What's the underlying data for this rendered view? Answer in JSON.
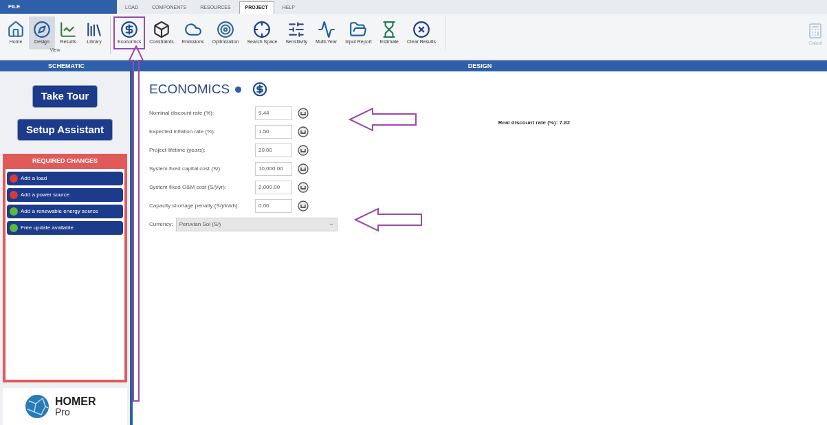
{
  "file_menu": "FILE",
  "menu_tabs": [
    {
      "label": "LOAD",
      "selected": false
    },
    {
      "label": "COMPONENTS",
      "selected": false
    },
    {
      "label": "RESOURCES",
      "selected": false
    },
    {
      "label": "PROJECT",
      "selected": true
    },
    {
      "label": "HELP",
      "selected": false
    }
  ],
  "ribbon": {
    "view_group": {
      "label": "View",
      "tools": [
        {
          "label": "Home",
          "selected": false
        },
        {
          "label": "Design",
          "selected": true
        },
        {
          "label": "Results",
          "selected": false
        },
        {
          "label": "Library",
          "selected": false
        }
      ]
    },
    "project_tools": [
      {
        "label": "Economics",
        "highlighted": true
      },
      {
        "label": "Constraints",
        "highlighted": false
      },
      {
        "label": "Emissions",
        "highlighted": false
      },
      {
        "label": "Optimization",
        "highlighted": false
      },
      {
        "label": "Search Space",
        "highlighted": false
      },
      {
        "label": "Sensitivity",
        "highlighted": false
      },
      {
        "label": "Multi-Year",
        "highlighted": false
      },
      {
        "label": "Input Report",
        "highlighted": false
      },
      {
        "label": "Estimate",
        "highlighted": false
      },
      {
        "label": "Clear Results",
        "highlighted": false
      }
    ],
    "calculate": {
      "label": "Calcul",
      "disabled": true
    }
  },
  "left_header": "SCHEMATIC",
  "right_header": "DESIGN",
  "sidebar": {
    "buttons": [
      "Take Tour",
      "Setup Assistant"
    ],
    "required_changes": {
      "title": "REQUIRED CHANGES",
      "items": [
        {
          "label": "Add a load",
          "color": "#d83a3a"
        },
        {
          "label": "Add a power source",
          "color": "#d83a3a"
        },
        {
          "label": "Add a renewable energy source",
          "color": "#5cb83c"
        },
        {
          "label": "Free update available",
          "color": "#5cb83c"
        }
      ]
    },
    "logo": {
      "name": "HOMER",
      "sub": "Pro"
    }
  },
  "economics": {
    "title": "ECONOMICS",
    "fields": [
      {
        "label": "Nominal discount rate (%):",
        "value": "9.44"
      },
      {
        "label": "Expected inflation rate (%):",
        "value": "1.50"
      },
      {
        "label": "Project lifetime (years):",
        "value": "20.00"
      },
      {
        "label": "System fixed capital cost (S/):",
        "value": "10,000.00"
      },
      {
        "label": "System fixed O&M cost (S/)/yr):",
        "value": "2,000.00"
      },
      {
        "label": "Capacity shortage penalty (S/)/kWh):",
        "value": "0.00"
      }
    ],
    "currency": {
      "label": "Currency:",
      "value": "Peruvian Sol (S/)"
    },
    "real_rate": "Real discount rate (%): 7.82"
  },
  "annotations": [
    {
      "kind": "up_arrow"
    },
    {
      "kind": "left_arrow"
    },
    {
      "kind": "left_arrow"
    }
  ]
}
